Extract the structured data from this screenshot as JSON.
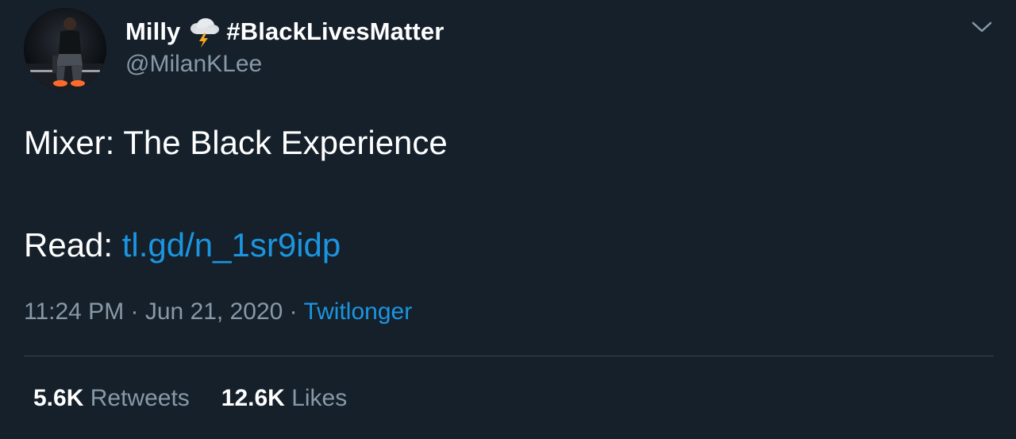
{
  "user": {
    "display_name": "Milly",
    "emoji_icon": "cloud-lightning-icon",
    "hashtag": "#BlackLivesMatter",
    "handle": "@MilanKLee"
  },
  "tweet": {
    "text_line1": "Mixer: The Black Experience",
    "read_label": "Read: ",
    "link_text": "tl.gd/n_1sr9idp",
    "time": "11:24 PM",
    "separator": " · ",
    "date": "Jun 21, 2020",
    "source": "Twitlonger"
  },
  "stats": {
    "retweets_count": "5.6K",
    "retweets_label": "Retweets",
    "likes_count": "12.6K",
    "likes_label": "Likes"
  },
  "colors": {
    "background": "#15202b",
    "text": "#ffffff",
    "secondary": "#8899a6",
    "link": "#1b95e0",
    "divider": "#38444d"
  }
}
